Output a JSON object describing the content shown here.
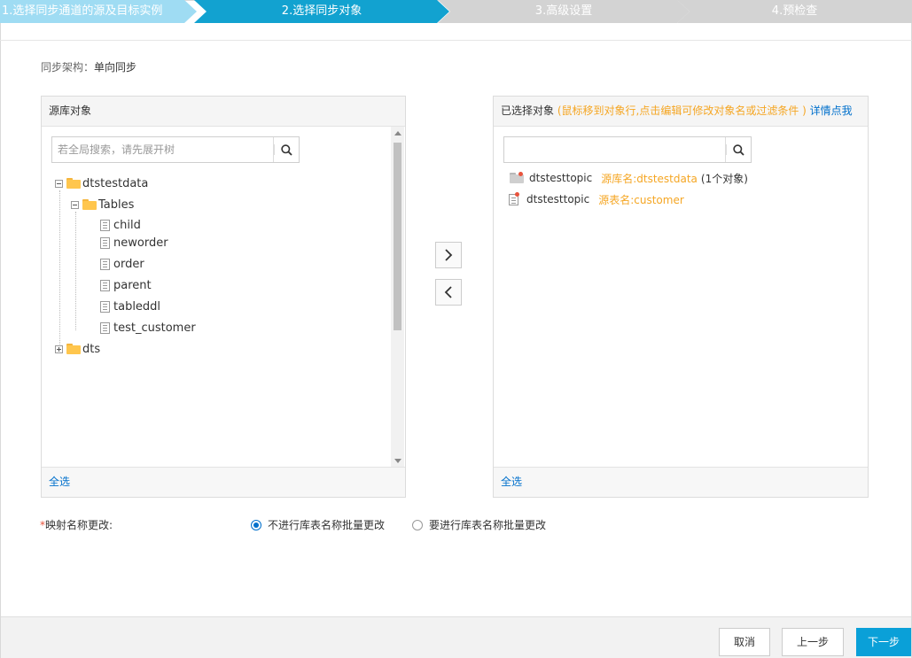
{
  "steps": [
    {
      "label": "1.选择同步通道的源及目标实例",
      "state": "done"
    },
    {
      "label": "2.选择同步对象",
      "state": "active"
    },
    {
      "label": "3.高级设置",
      "state": "pending"
    },
    {
      "label": "4.预检查",
      "state": "pending"
    }
  ],
  "architecture": {
    "label": "同步架构：",
    "value": "单向同步"
  },
  "source_panel": {
    "title": "源库对象",
    "search_placeholder": "若全局搜索，请先展开树",
    "tree": {
      "db1": "dtstestdata",
      "tables_node": "Tables",
      "tables": [
        "child",
        "neworder",
        "order",
        "parent",
        "tableddl",
        "test_customer"
      ],
      "db2": "dts"
    },
    "select_all": "全选"
  },
  "target_panel": {
    "title": "已选择对象",
    "hint": "(鼠标移到对象行,点击编辑可修改对象名或过滤条件 )",
    "detail_link": "详情点我",
    "search_placeholder": "",
    "items": [
      {
        "name": "dtstesttopic",
        "source": "源库名:dtstestdata",
        "count": "(1个对象)"
      },
      {
        "name": "dtstesttopic",
        "source": "源表名:customer"
      }
    ],
    "select_all": "全选"
  },
  "mapping": {
    "required_mark": "*",
    "label": "映射名称更改:",
    "options": [
      {
        "label": "不进行库表名称批量更改",
        "selected": true
      },
      {
        "label": "要进行库表名称批量更改",
        "selected": false
      }
    ]
  },
  "footer": {
    "cancel": "取消",
    "prev": "上一步",
    "next": "下一步"
  },
  "colors": {
    "active_step": "#12a2d0",
    "done_step": "#9fdcf3",
    "pending_step": "#d3d3d3",
    "link": "#0070cc",
    "warning": "#f5a623",
    "primary_button": "#0aa0d8"
  }
}
